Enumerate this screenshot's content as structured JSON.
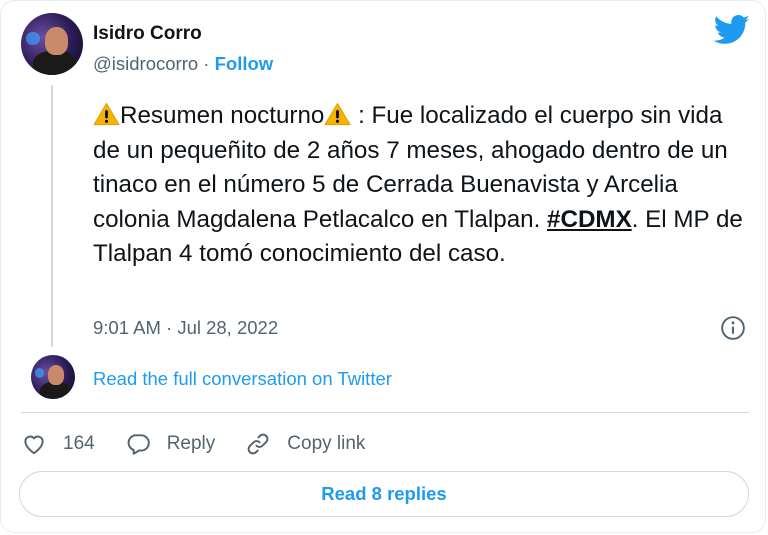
{
  "author": {
    "name": "Isidro Corro",
    "handle": "@isidrocorro",
    "separator": " · ",
    "follow_label": "Follow"
  },
  "tweet": {
    "part1": "Resumen nocturno",
    "part2": " : Fue localizado el cuerpo sin vida de un pequeñito de 2 años 7 meses, ahogado dentro de un tinaco en el número 5 de Cerrada Buenavista y Arcelia colonia Magdalena Petlacalco en Tlalpan. ",
    "hashtag": "#CDMX",
    "part3": ". El MP de Tlalpan 4 tomó conocimiento del caso.",
    "timestamp": "9:01 AM · Jul 28, 2022"
  },
  "conversation_link": "Read the full conversation on Twitter",
  "actions": {
    "likes_count": "164",
    "reply_label": "Reply",
    "copy_link_label": "Copy link"
  },
  "read_replies_label": "Read 8 replies",
  "icons": {
    "brand": "twitter-bird-icon",
    "warning": "warning-icon",
    "info": "info-icon",
    "like": "heart-icon",
    "reply": "speech-bubble-icon",
    "copy_link": "link-icon"
  },
  "colors": {
    "accent": "#1d9bf0",
    "text": "#0f1419",
    "secondary": "#536471",
    "warning": "#f4b400"
  }
}
